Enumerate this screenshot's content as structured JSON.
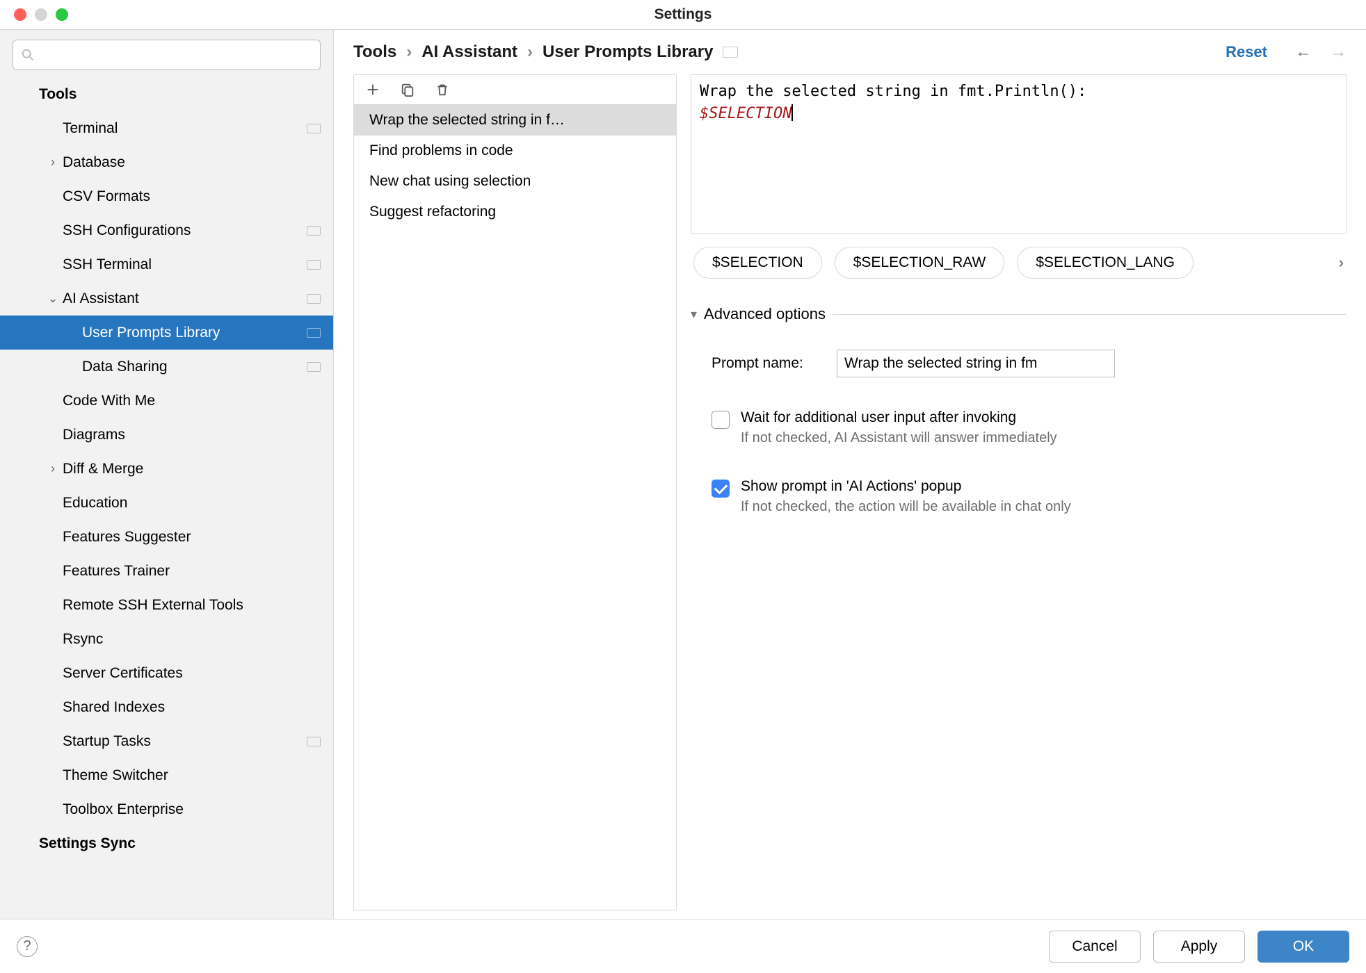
{
  "window": {
    "title": "Settings"
  },
  "sidebar": {
    "search_placeholder": "",
    "items": [
      {
        "label": "Tools",
        "level": 0,
        "chevron": "",
        "tag": false,
        "selected": false
      },
      {
        "label": "Terminal",
        "level": 1,
        "chevron": "",
        "tag": true,
        "selected": false
      },
      {
        "label": "Database",
        "level": 1,
        "chevron": ">",
        "tag": false,
        "selected": false
      },
      {
        "label": "CSV Formats",
        "level": 1,
        "chevron": "",
        "tag": false,
        "selected": false
      },
      {
        "label": "SSH Configurations",
        "level": 1,
        "chevron": "",
        "tag": true,
        "selected": false
      },
      {
        "label": "SSH Terminal",
        "level": 1,
        "chevron": "",
        "tag": true,
        "selected": false
      },
      {
        "label": "AI Assistant",
        "level": 1,
        "chevron": "v",
        "tag": true,
        "selected": false
      },
      {
        "label": "User Prompts Library",
        "level": 2,
        "chevron": "",
        "tag": true,
        "selected": true
      },
      {
        "label": "Data Sharing",
        "level": 2,
        "chevron": "",
        "tag": true,
        "selected": false
      },
      {
        "label": "Code With Me",
        "level": 1,
        "chevron": "",
        "tag": false,
        "selected": false
      },
      {
        "label": "Diagrams",
        "level": 1,
        "chevron": "",
        "tag": false,
        "selected": false
      },
      {
        "label": "Diff & Merge",
        "level": 1,
        "chevron": ">",
        "tag": false,
        "selected": false
      },
      {
        "label": "Education",
        "level": 1,
        "chevron": "",
        "tag": false,
        "selected": false
      },
      {
        "label": "Features Suggester",
        "level": 1,
        "chevron": "",
        "tag": false,
        "selected": false
      },
      {
        "label": "Features Trainer",
        "level": 1,
        "chevron": "",
        "tag": false,
        "selected": false
      },
      {
        "label": "Remote SSH External Tools",
        "level": 1,
        "chevron": "",
        "tag": false,
        "selected": false
      },
      {
        "label": "Rsync",
        "level": 1,
        "chevron": "",
        "tag": false,
        "selected": false
      },
      {
        "label": "Server Certificates",
        "level": 1,
        "chevron": "",
        "tag": false,
        "selected": false
      },
      {
        "label": "Shared Indexes",
        "level": 1,
        "chevron": "",
        "tag": false,
        "selected": false
      },
      {
        "label": "Startup Tasks",
        "level": 1,
        "chevron": "",
        "tag": true,
        "selected": false
      },
      {
        "label": "Theme Switcher",
        "level": 1,
        "chevron": "",
        "tag": false,
        "selected": false
      },
      {
        "label": "Toolbox Enterprise",
        "level": 1,
        "chevron": "",
        "tag": false,
        "selected": false
      },
      {
        "label": "Settings Sync",
        "level": 0,
        "chevron": "",
        "tag": false,
        "selected": false
      }
    ]
  },
  "header": {
    "breadcrumb": [
      "Tools",
      "AI Assistant",
      "User Prompts Library"
    ],
    "reset": "Reset"
  },
  "prompts": {
    "items": [
      {
        "label": "Wrap the selected string in f…",
        "selected": true
      },
      {
        "label": "Find problems in code",
        "selected": false
      },
      {
        "label": "New chat using selection",
        "selected": false
      },
      {
        "label": "Suggest refactoring",
        "selected": false
      }
    ]
  },
  "editor": {
    "line1": "Wrap the selected string in fmt.Println():",
    "variable": "$SELECTION"
  },
  "tokens": [
    "$SELECTION",
    "$SELECTION_RAW",
    "$SELECTION_LANG"
  ],
  "advanced": {
    "title": "Advanced options",
    "prompt_name_label": "Prompt name:",
    "prompt_name_value": "Wrap the selected string in fm",
    "wait": {
      "title": "Wait for additional user input after invoking",
      "hint": "If not checked, AI Assistant will answer immediately",
      "checked": false
    },
    "show": {
      "title": "Show prompt in 'AI Actions' popup",
      "hint": "If not checked, the action will be available in chat only",
      "checked": true
    }
  },
  "footer": {
    "cancel": "Cancel",
    "apply": "Apply",
    "ok": "OK"
  }
}
